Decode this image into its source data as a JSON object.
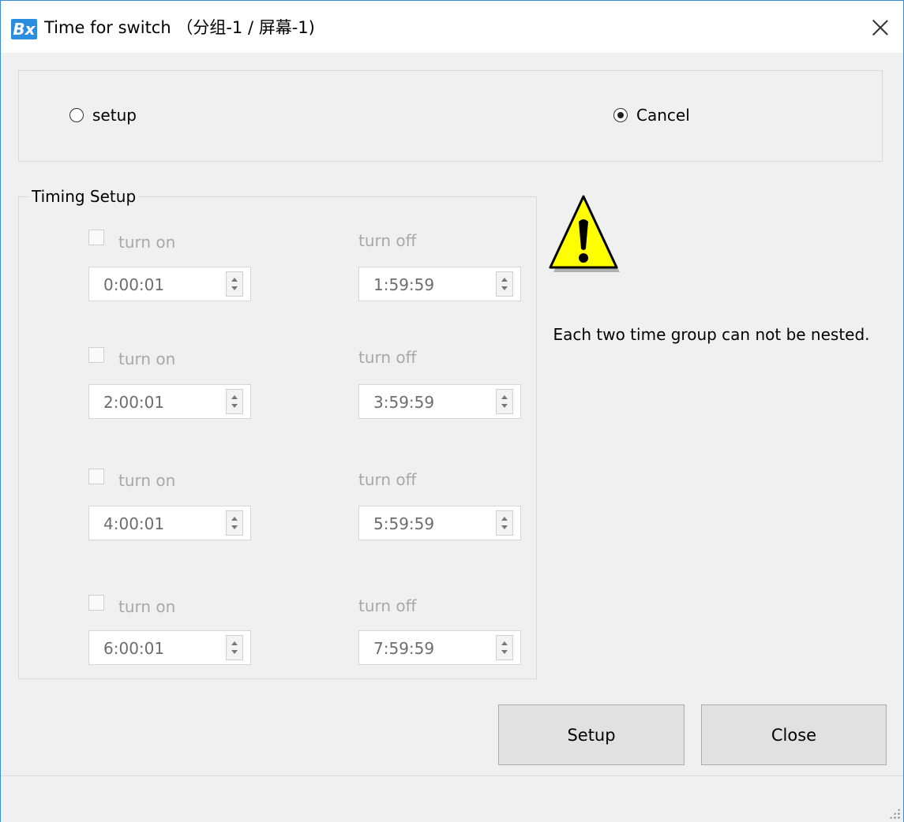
{
  "window": {
    "app_icon": "Bx",
    "title": "Time for switch （分组-1 / 屏幕-1)",
    "close_icon": "close-icon"
  },
  "mode": {
    "setup_label": "setup",
    "setup_checked": false,
    "cancel_label": "Cancel",
    "cancel_checked": true
  },
  "timing": {
    "legend": "Timing Setup",
    "groups": [
      {
        "enabled": false,
        "on_label": "turn on",
        "off_label": "turn off",
        "on_time": "0:00:01",
        "off_time": "1:59:59"
      },
      {
        "enabled": false,
        "on_label": "turn on",
        "off_label": "turn off",
        "on_time": "2:00:01",
        "off_time": "3:59:59"
      },
      {
        "enabled": false,
        "on_label": "turn on",
        "off_label": "turn off",
        "on_time": "4:00:01",
        "off_time": "5:59:59"
      },
      {
        "enabled": false,
        "on_label": "turn on",
        "off_label": "turn off",
        "on_time": "6:00:01",
        "off_time": "7:59:59"
      }
    ]
  },
  "notice": {
    "icon": "warning-icon",
    "message": "Each two time group can not be nested."
  },
  "buttons": {
    "setup": "Setup",
    "close": "Close"
  }
}
